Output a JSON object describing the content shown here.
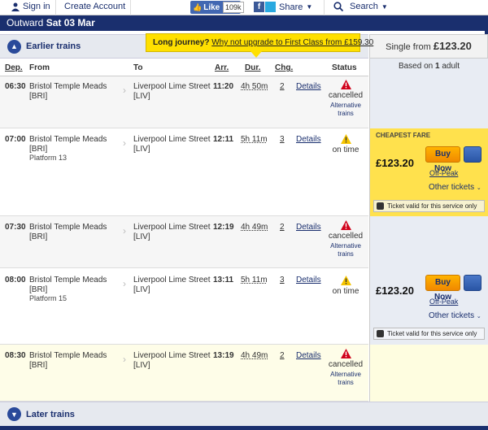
{
  "topbar": {
    "signin": "Sign in",
    "create_account": "Create Account",
    "like": "Like",
    "like_count": "109k",
    "share": "Share",
    "search": "Search"
  },
  "navbar": {
    "prefix": "Outward",
    "date": "Sat 03 Mar"
  },
  "earlier": "Earlier trains",
  "later": "Later trains",
  "promo": {
    "bold": "Long journey?",
    "link": "Why not upgrade to First Class from £159.30"
  },
  "single": {
    "prefix": "Single from",
    "price": "£123.20"
  },
  "based": {
    "prefix": "Based on",
    "count": "1",
    "suffix": "adult"
  },
  "columns": {
    "dep": "Dep.",
    "from": "From",
    "to": "To",
    "arr": "Arr.",
    "dur": "Dur.",
    "chg": "Chg.",
    "status": "Status"
  },
  "rows": [
    {
      "dep": "06:30",
      "from": "Bristol Temple Meads",
      "from_code": "[BRI]",
      "platform": "",
      "to": "Liverpool Lime Street",
      "to_code": "[LIV]",
      "arr": "11:20",
      "dur": "4h 50m",
      "chg": "2",
      "details": "Details",
      "status": "cancelled",
      "status_note": "Alternative trains"
    },
    {
      "dep": "07:00",
      "from": "Bristol Temple Meads",
      "from_code": "[BRI]",
      "platform": "Platform 13",
      "to": "Liverpool Lime Street",
      "to_code": "[LIV]",
      "arr": "12:11",
      "dur": "5h 11m",
      "chg": "3",
      "details": "Details",
      "status": "on time",
      "status_note": ""
    },
    {
      "dep": "07:30",
      "from": "Bristol Temple Meads",
      "from_code": "[BRI]",
      "platform": "",
      "to": "Liverpool Lime Street",
      "to_code": "[LIV]",
      "arr": "12:19",
      "dur": "4h 49m",
      "chg": "2",
      "details": "Details",
      "status": "cancelled",
      "status_note": "Alternative trains"
    },
    {
      "dep": "08:00",
      "from": "Bristol Temple Meads",
      "from_code": "[BRI]",
      "platform": "Platform 15",
      "to": "Liverpool Lime Street",
      "to_code": "[LIV]",
      "arr": "13:11",
      "dur": "5h 11m",
      "chg": "3",
      "details": "Details",
      "status": "on time",
      "status_note": ""
    },
    {
      "dep": "08:30",
      "from": "Bristol Temple Meads",
      "from_code": "[BRI]",
      "platform": "",
      "to": "Liverpool Lime Street",
      "to_code": "[LIV]",
      "arr": "13:19",
      "dur": "4h 49m",
      "chg": "2",
      "details": "Details",
      "status": "cancelled",
      "status_note": "Alternative trains"
    }
  ],
  "fares": {
    "cheapest_label": "CHEAPEST FARE",
    "price": "£123.20",
    "buy": "Buy Now",
    "offpeak": "Off-Peak",
    "other": "Other tickets",
    "valid": "Ticket valid for this service only"
  },
  "colors": {
    "navy": "#1a2f6e",
    "cheapest": "#ffe14d",
    "buy": "#f7a500",
    "warning_red": "#d0021b",
    "warning_yellow": "#f5c400"
  }
}
